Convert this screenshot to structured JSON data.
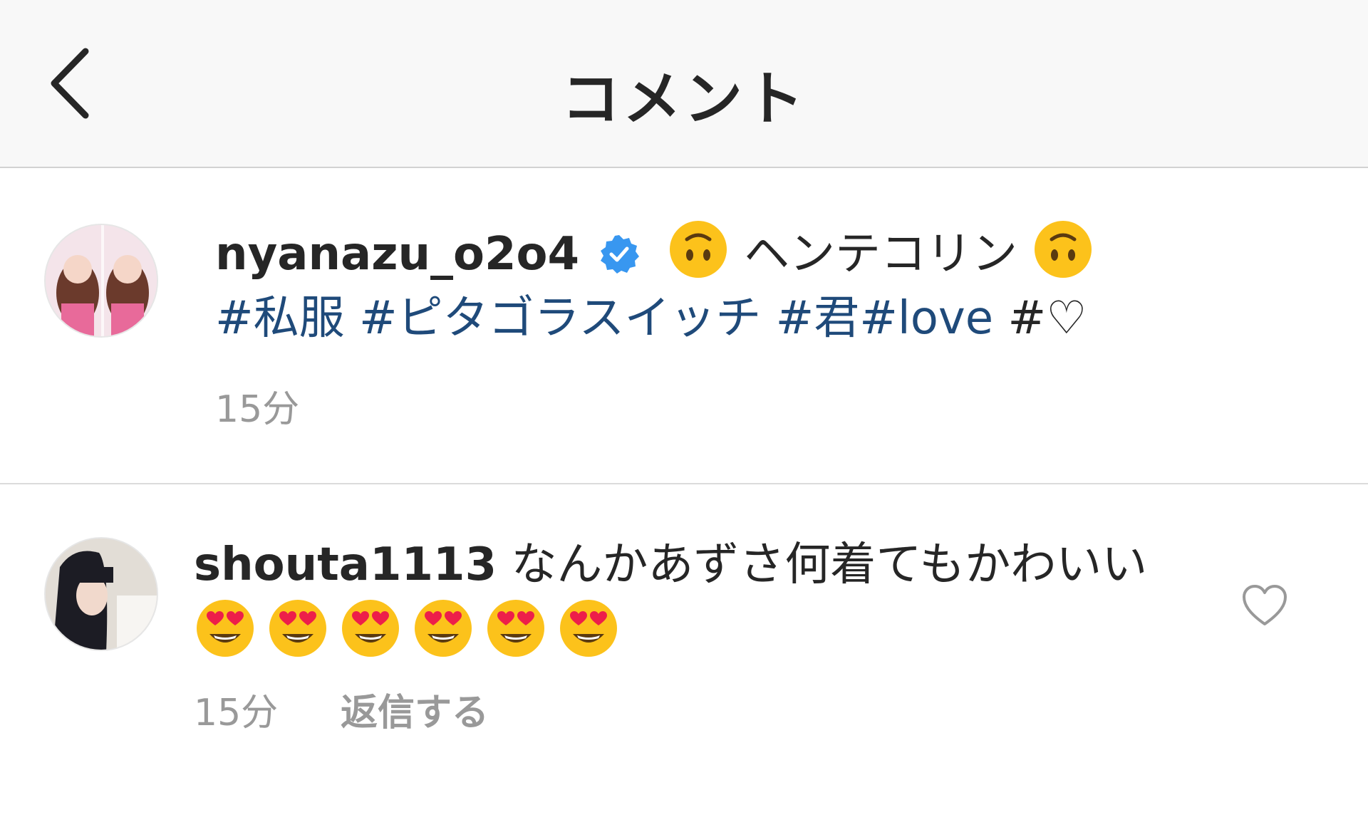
{
  "header": {
    "title": "コメント",
    "back_icon": "chevron-left-icon"
  },
  "caption": {
    "username": "nyanazu_o2o4",
    "verified_icon": "verified-badge-icon",
    "emoji_before": "upside-down-face-emoji",
    "text": "ヘンテコリン",
    "emoji_after": "upside-down-face-emoji",
    "hashtags": [
      "#私服",
      "#ピタゴラスイッチ",
      "#君",
      "#love"
    ],
    "trailing": "#♡",
    "time": "15分"
  },
  "comment": {
    "username": "shouta1113",
    "text": "なんかあずさ何着てもかわいい",
    "emoji": "heart-eyes-emoji",
    "emoji_count": 6,
    "time": "15分",
    "reply_label": "返信する",
    "like_icon": "heart-outline-icon"
  },
  "colors": {
    "header_bg": "#f8f8f8",
    "hashtag": "#1f4a7a",
    "meta": "#999999",
    "verified": "#3897f0",
    "text": "#262626"
  }
}
